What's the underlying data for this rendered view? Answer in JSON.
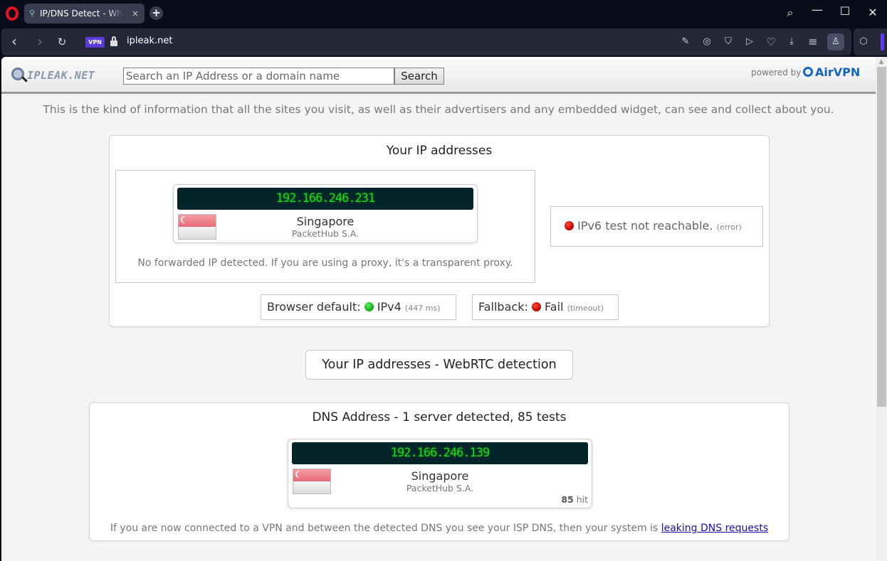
{
  "browser": {
    "tab_title": "IP/DNS Detect - What is your IP",
    "tab_close": "×",
    "new_tab": "+",
    "url": "ipleak.net",
    "vpn_badge": "VPN",
    "icons": {
      "back": "‹",
      "forward": "›",
      "reload": "↻",
      "search": "⌕",
      "minimize": "—",
      "maximize": "☐",
      "close": "✕",
      "snapshot_edit": "✎",
      "camera": "◎",
      "shield": "⛉",
      "send": "▷",
      "heart": "♡",
      "download": "⤓",
      "menu": "≡",
      "profile": "♙",
      "cube": "⬡"
    }
  },
  "site": {
    "logo_text": "IPLEAK.NET",
    "search_placeholder": "Search an IP Address or a domain name",
    "search_button": "Search",
    "powered_by": "powered by",
    "brand": "AirVPN",
    "intro": "This is the kind of information that all the sites you visit, as well as their advertisers and any embedded widget, can see and collect about you."
  },
  "ip_section": {
    "title": "Your IP addresses",
    "ipv4": {
      "address": "192.166.246.231",
      "country": "Singapore",
      "isp": "PacketHub S.A."
    },
    "forwarded_note": "No forwarded IP detected. If you are using a proxy, it's a transparent proxy.",
    "ipv6": {
      "status": "IPv6 test not reachable.",
      "detail": "(error)"
    },
    "browser_default": {
      "label": "Browser default:",
      "value": "IPv4",
      "detail": "(447 ms)"
    },
    "fallback": {
      "label": "Fallback:",
      "value": "Fail",
      "detail": "(timeout)"
    }
  },
  "webrtc": {
    "label": "Your IP addresses - WebRTC detection"
  },
  "dns_section": {
    "title": "DNS Address - 1 server detected, 85 tests",
    "server": {
      "address": "192.166.246.139",
      "country": "Singapore",
      "isp": "PacketHub S.A.",
      "hits": "85",
      "hit_label": "hit"
    },
    "note": "If you are now connected to a VPN and between the detected DNS you see your ISP DNS, then your system is",
    "link": "leaking DNS requests"
  },
  "colors": {
    "ip_green": "#1fd41f",
    "ip_bg": "#04242b",
    "status_red": "#b50000",
    "status_green": "#13a813",
    "brand_blue": "#1565c0",
    "vpn_purple": "#5b3bd8"
  }
}
